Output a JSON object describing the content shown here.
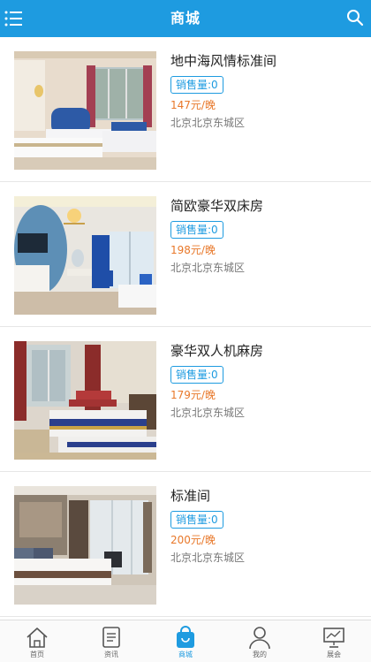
{
  "header": {
    "title": "商城",
    "menu_icon": "menu-icon",
    "search_icon": "search-icon",
    "bg_color": "#1e9be0"
  },
  "rooms": [
    {
      "name": "地中海风情标准间",
      "sales": "销售量:0",
      "price": "147元/晚",
      "location": "北京北京东城区"
    },
    {
      "name": "简欧豪华双床房",
      "sales": "销售量:0",
      "price": "198元/晚",
      "location": "北京北京东城区"
    },
    {
      "name": "豪华双人机麻房",
      "sales": "销售量:0",
      "price": "179元/晚",
      "location": "北京北京东城区"
    },
    {
      "name": "标准间",
      "sales": "销售量:0",
      "price": "200元/晚",
      "location": "北京北京东城区"
    }
  ],
  "tabbar": {
    "active": "商城",
    "tabs": [
      {
        "label": "首页",
        "icon": "home-icon"
      },
      {
        "label": "资讯",
        "icon": "news-icon"
      },
      {
        "label": "商城",
        "icon": "shop-bag-icon"
      },
      {
        "label": "我的",
        "icon": "user-icon"
      },
      {
        "label": "展会",
        "icon": "exhibition-icon"
      }
    ]
  },
  "colors": {
    "accent": "#1e9be0",
    "price": "#e8782a"
  }
}
